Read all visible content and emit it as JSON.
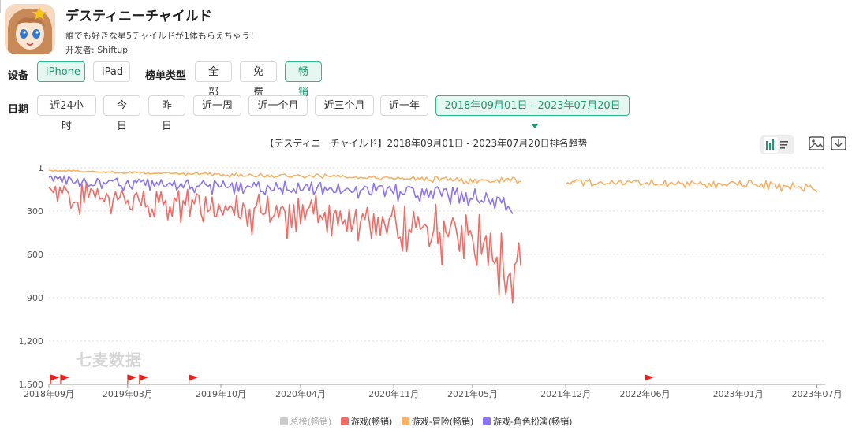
{
  "app": {
    "title": "デスティニーチャイルド",
    "description": "誰でも好きな星5チャイルドが1体もらえちゃう！",
    "developer": "开发者: Shiftup"
  },
  "filters": {
    "device_label": "设备",
    "device_options": [
      "iPhone",
      "iPad"
    ],
    "device_selected": "iPhone",
    "chart_type_label": "榜单类型",
    "chart_type_options": [
      "全部",
      "免费",
      "畅销"
    ],
    "chart_type_selected": "畅销",
    "date_label": "日期",
    "date_options": [
      "近24小时",
      "今日",
      "昨日",
      "近一周",
      "近一个月",
      "近三个月",
      "近一年"
    ],
    "date_range": "2018年09月01日 - 2023年07月20日"
  },
  "watermark": "七麦数据",
  "colors": {
    "total": "#cccccc",
    "games": "#f26b64",
    "adventure": "#f8b165",
    "rpg": "#8b74f5",
    "accent": "#2bb98a",
    "flag": "#e8221a"
  },
  "chart_data": {
    "type": "line",
    "title": "【デスティニーチャイルド】2018年09月01日 - 2023年07月20日排名趋势",
    "y_reversed": true,
    "ylim": [
      1,
      1500
    ],
    "y_ticks": [
      "1",
      "300",
      "600",
      "900",
      "1,200",
      "1,500"
    ],
    "x_ticks": [
      "2018年09月",
      "2019年03月",
      "2019年10月",
      "2020年04月",
      "2020年11月",
      "2021年05月",
      "2021年12月",
      "2022年06月",
      "2023年01月",
      "2023年07月"
    ],
    "x_tick_dates": [
      "2018-09",
      "2019-03",
      "2019-10",
      "2020-04",
      "2020-11",
      "2021-05",
      "2021-12",
      "2022-06",
      "2023-01",
      "2023-07"
    ],
    "xlim": [
      "2018-09-01",
      "2023-07-20"
    ],
    "grid": true,
    "legend_position": "bottom",
    "legend": [
      "总榜(畅销)",
      "游戏(畅销)",
      "游戏-冒险(畅销)",
      "游戏-角色扮演(畅销)"
    ],
    "legend_disabled": [
      "总榜(畅销)"
    ],
    "series": [
      {
        "name": "游戏(畅销)",
        "color": "#f26b64",
        "points": [
          [
            "2018-09",
            150
          ],
          [
            "2018-10",
            210
          ],
          [
            "2018-11",
            280
          ],
          [
            "2018-12",
            200
          ],
          [
            "2019-01",
            260
          ],
          [
            "2019-02",
            250
          ],
          [
            "2019-03",
            290
          ],
          [
            "2019-04",
            300
          ],
          [
            "2019-05",
            310
          ],
          [
            "2019-06",
            330
          ],
          [
            "2019-07",
            340
          ],
          [
            "2019-08",
            320
          ],
          [
            "2019-09",
            330
          ],
          [
            "2019-10",
            360
          ],
          [
            "2019-11",
            340
          ],
          [
            "2019-12",
            370
          ],
          [
            "2020-01",
            380
          ],
          [
            "2020-02",
            390
          ],
          [
            "2020-03",
            400
          ],
          [
            "2020-04",
            420
          ],
          [
            "2020-05",
            410
          ],
          [
            "2020-06",
            430
          ],
          [
            "2020-07",
            440
          ],
          [
            "2020-08",
            450
          ],
          [
            "2020-09",
            460
          ],
          [
            "2020-10",
            470
          ],
          [
            "2020-11",
            480
          ],
          [
            "2020-12",
            500
          ],
          [
            "2021-01",
            520
          ],
          [
            "2021-02",
            540
          ],
          [
            "2021-03",
            560
          ],
          [
            "2021-04",
            580
          ],
          [
            "2021-05",
            620
          ],
          [
            "2021-06",
            700
          ],
          [
            "2021-07",
            780
          ],
          [
            "2021-08",
            1030
          ],
          [
            "2021-08-20",
            680
          ]
        ]
      },
      {
        "name": "游戏-冒险(畅销)",
        "color": "#f8b165",
        "points": [
          [
            "2018-09",
            20
          ],
          [
            "2018-12",
            30
          ],
          [
            "2019-03",
            40
          ],
          [
            "2019-06",
            45
          ],
          [
            "2019-09",
            50
          ],
          [
            "2019-12",
            60
          ],
          [
            "2020-03",
            65
          ],
          [
            "2020-06",
            70
          ],
          [
            "2020-09",
            75
          ],
          [
            "2020-12",
            85
          ],
          [
            "2021-03",
            95
          ],
          [
            "2021-06",
            105
          ],
          [
            "2021-08",
            100
          ],
          [
            "2021-12",
            110
          ],
          [
            "2022-03",
            120
          ],
          [
            "2022-06",
            125
          ],
          [
            "2022-09",
            120
          ],
          [
            "2022-12",
            130
          ],
          [
            "2023-03",
            135
          ],
          [
            "2023-07",
            170
          ]
        ]
      },
      {
        "name": "游戏-角色扮演(畅销)",
        "color": "#8b74f5",
        "points": [
          [
            "2018-09",
            90
          ],
          [
            "2018-12",
            120
          ],
          [
            "2019-03",
            130
          ],
          [
            "2019-06",
            140
          ],
          [
            "2019-09",
            150
          ],
          [
            "2019-12",
            160
          ],
          [
            "2020-03",
            170
          ],
          [
            "2020-06",
            180
          ],
          [
            "2020-09",
            190
          ],
          [
            "2020-12",
            200
          ],
          [
            "2021-03",
            220
          ],
          [
            "2021-06",
            250
          ],
          [
            "2021-08",
            320
          ]
        ]
      }
    ],
    "event_markers": [
      "2018-09-05",
      "2018-09-28",
      "2019-03-01",
      "2019-03-28",
      "2019-07-20",
      "2022-06-01"
    ]
  }
}
